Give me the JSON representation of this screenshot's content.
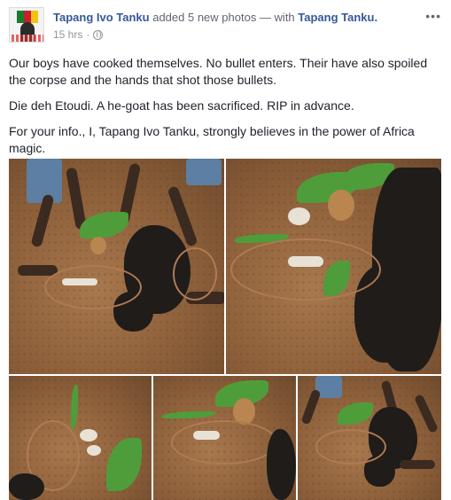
{
  "post": {
    "author": "Tapang Ivo Tanku",
    "action": "added 5 new photos — with",
    "tagged": "Tapang Tanku.",
    "time": "15 hrs",
    "separator": "·",
    "more": "•••",
    "paragraphs": [
      "Our boys have cooked themselves. No bullet enters. Their have also spoiled the corpse and the hands that shot those bullets.",
      "Die deh Etoudi. A he-goat has been sacrificed. RIP in advance.",
      "For your info., I, Tapang Ivo Tanku, strongly believes in the power of Africa magic."
    ]
  },
  "photos": {
    "count": 5
  }
}
